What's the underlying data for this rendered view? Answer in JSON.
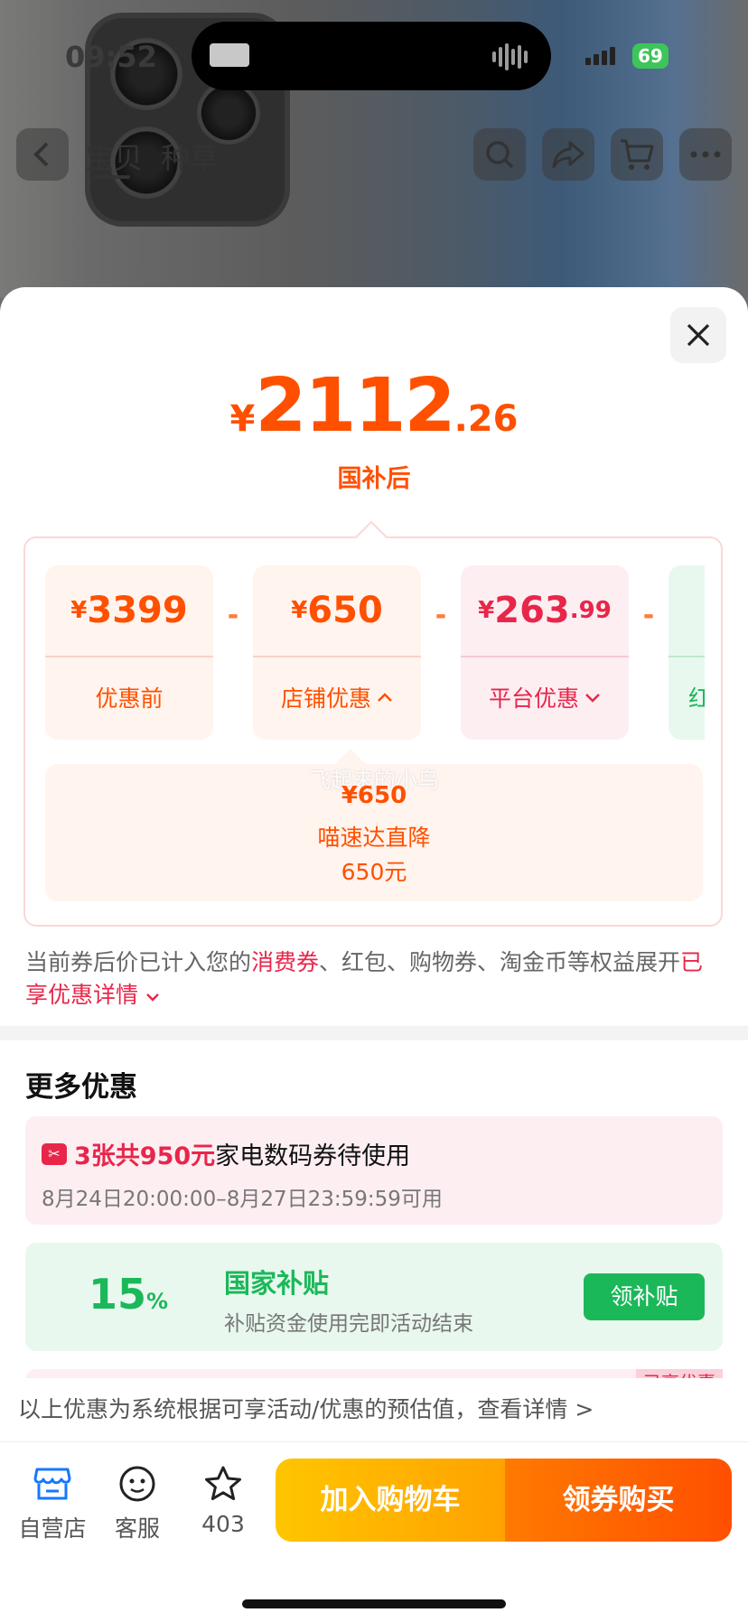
{
  "status": {
    "time": "09:52",
    "battery": "69"
  },
  "nav": {
    "tabs": [
      "宝贝",
      "种草"
    ]
  },
  "price": {
    "symbol": "¥",
    "integer": "2112",
    "decimal": ".26",
    "label": "国补后"
  },
  "breakdown": {
    "cards": [
      {
        "symbol": "¥",
        "integer": "3399",
        "decimal": "",
        "label": "优惠前"
      },
      {
        "symbol": "¥",
        "integer": "650",
        "decimal": "",
        "label": "店铺优惠"
      },
      {
        "symbol": "¥",
        "integer": "263",
        "decimal": ".99",
        "label": "平台优惠"
      },
      {
        "symbol": "¥",
        "integer": "",
        "decimal": "",
        "label": "红"
      }
    ],
    "minus": "-",
    "detail": {
      "amount": "¥650",
      "line1": "喵速达直降",
      "line2": "650元"
    },
    "watermark": "飞起来的小鸟"
  },
  "note": {
    "before": "当前券后价已计入您的",
    "highlight": "消费券",
    "after": "、红包、购物券、淘金币等权益展开",
    "link": "已享优惠详情"
  },
  "more": {
    "title": "更多优惠",
    "coupon": {
      "highlight": "3张共950元",
      "title_rest": "家电数码券待使用",
      "date": "8月24日20:00:00–8月27日23:59:59可用"
    },
    "subsidy": {
      "pct": "15",
      "pct_sign": "%",
      "name": "国家补贴",
      "desc": "补贴资金使用完即活动结束",
      "button": "领补贴"
    },
    "peek_tag": "已享优惠"
  },
  "disclaimer": "以上优惠为系统根据可享活动/优惠的预估值，查看详情 >",
  "bottom": {
    "store": "自营店",
    "service": "客服",
    "fav_count": "403",
    "add_cart": "加入购物车",
    "buy": "领券购买"
  }
}
